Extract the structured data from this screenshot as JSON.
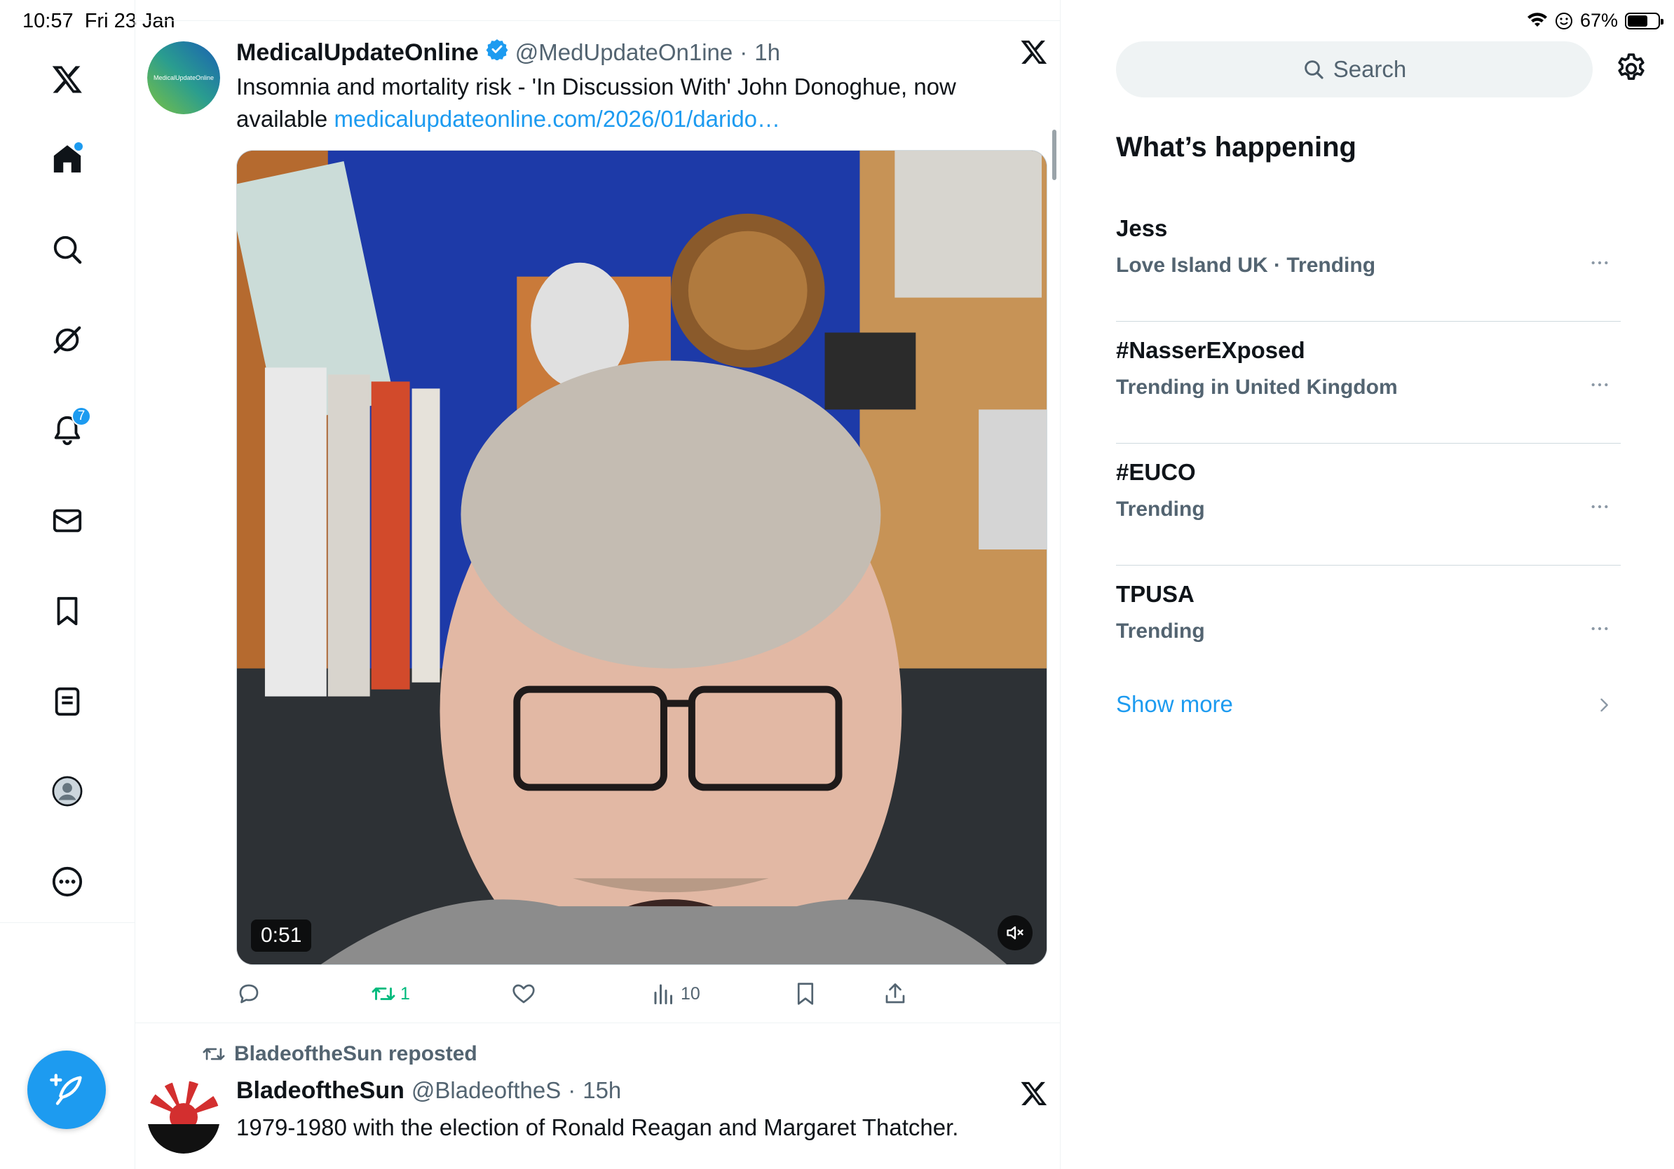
{
  "status_bar": {
    "time": "10:57",
    "date": "Fri 23 Jan",
    "battery": "67%",
    "battery_level": 0.67
  },
  "nav": {
    "notifications_badge": "7",
    "items": [
      "x-logo",
      "home",
      "explore",
      "grok",
      "notifications",
      "messages",
      "bookmarks",
      "lists",
      "profile",
      "more"
    ]
  },
  "tweets": [
    {
      "avatar_text": "MedicalUpdateOnline",
      "name": "MedicalUpdateOnline",
      "handle": "@MedUpdateOn1ine",
      "sep": "·",
      "time": "1h",
      "text": "Insomnia and mortality risk - 'In Discussion With' John Donoghue, now available ",
      "link": "medicalupdateonline.com/2026/01/darido…",
      "video_duration": "0:51",
      "actions": {
        "reply": "",
        "repost": "1",
        "like": "",
        "views": "10"
      }
    },
    {
      "repost_label": "BladeoftheSun reposted",
      "name": "BladeoftheSun",
      "handle": "@BladeoftheS",
      "sep": "·",
      "time": "15h",
      "text": "1979-1980 with the election of Ronald Reagan and Margaret Thatcher."
    }
  ],
  "sidebar": {
    "search_placeholder": "Search",
    "title": "What’s happening",
    "trends": [
      {
        "name": "Jess",
        "meta": "Love Island UK · Trending"
      },
      {
        "name": "#NasserEXposed",
        "meta": "Trending in United Kingdom"
      },
      {
        "name": "#EUCO",
        "meta": "Trending"
      },
      {
        "name": "TPUSA",
        "meta": "Trending"
      }
    ],
    "show_more": "Show more"
  },
  "colors": {
    "accent": "#1d9bf0",
    "repost_green": "#00ba7c",
    "text_primary": "#0f1419",
    "text_secondary": "#536471"
  }
}
